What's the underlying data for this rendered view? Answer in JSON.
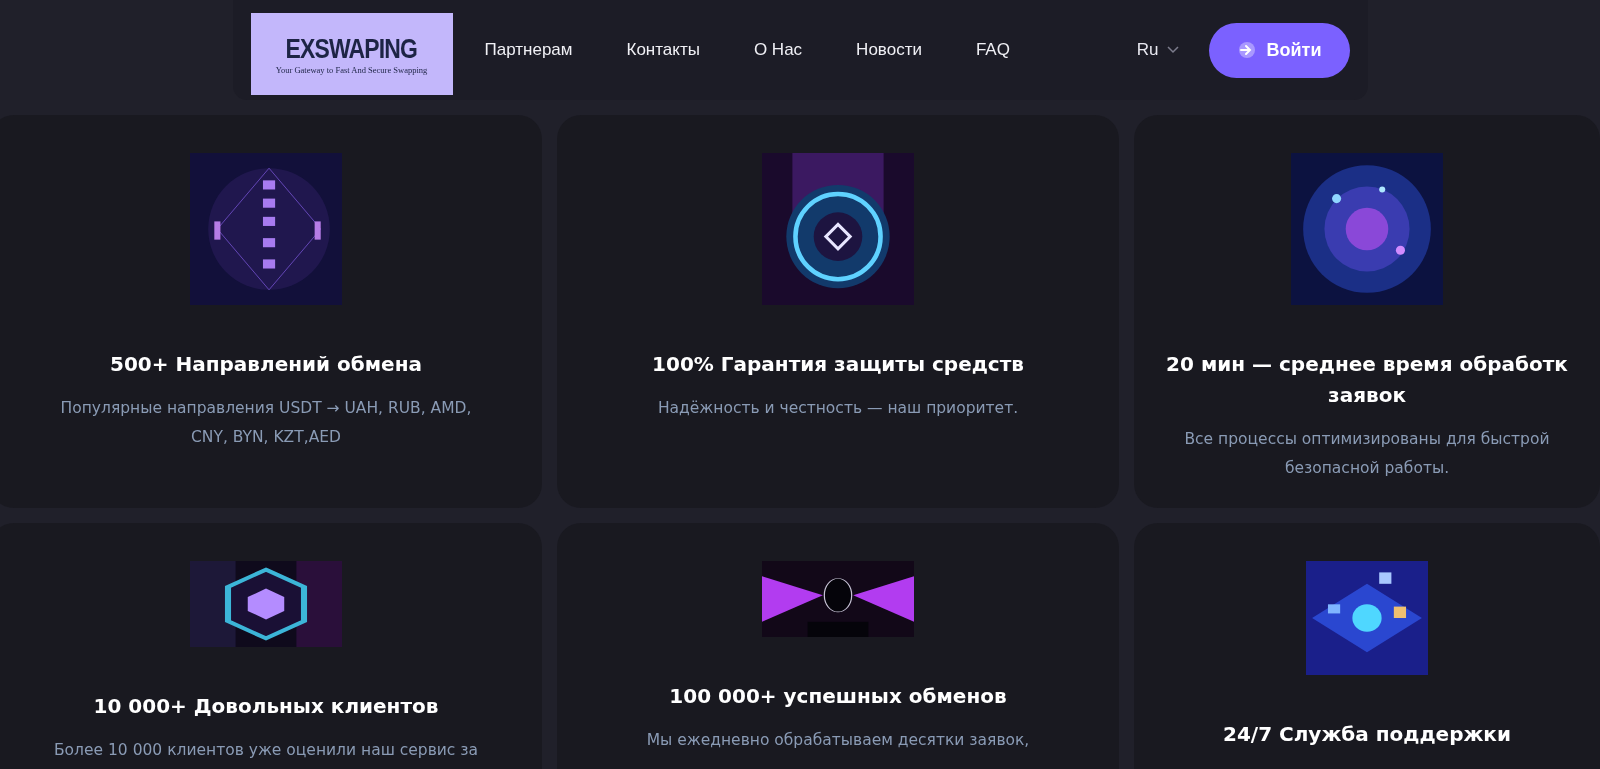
{
  "header": {
    "logo": {
      "title": "EXSWAPING",
      "tagline": "Your Gateway to Fast And Secure Swapping"
    },
    "nav": [
      "Партнерам",
      "Контакты",
      "О Нас",
      "Новости",
      "FAQ"
    ],
    "language": "Ru",
    "login": "Войти"
  },
  "cards": [
    {
      "kind": "network",
      "title": [
        "500+ Направлений обмена"
      ],
      "description": [
        "Популярные направления USDT → UAH, RUB, AMD,",
        "CNY, BYN, KZT,AED"
      ]
    },
    {
      "kind": "orb",
      "title": [
        "100% Гарантия защиты средств"
      ],
      "description": [
        "Надёжность и честность — наш приоритет."
      ]
    },
    {
      "kind": "galaxy",
      "title": [
        "20 мин — среднее время обработк",
        "заявок"
      ],
      "description": [
        "Все процессы оптимизированы для быстрой",
        "безопасной работы."
      ]
    },
    {
      "kind": "hexagon",
      "title": [
        "10 000+ Довольных клиентов"
      ],
      "description": [
        "Более 10 000 клиентов уже оценили наш сервис за"
      ]
    },
    {
      "kind": "wings",
      "title": [
        "100 000+ успешных обменов"
      ],
      "description": [
        "Мы ежедневно обрабатываем десятки заявок,"
      ]
    },
    {
      "kind": "isometric",
      "title": [
        "24/7 Служба поддержки"
      ]
    }
  ]
}
